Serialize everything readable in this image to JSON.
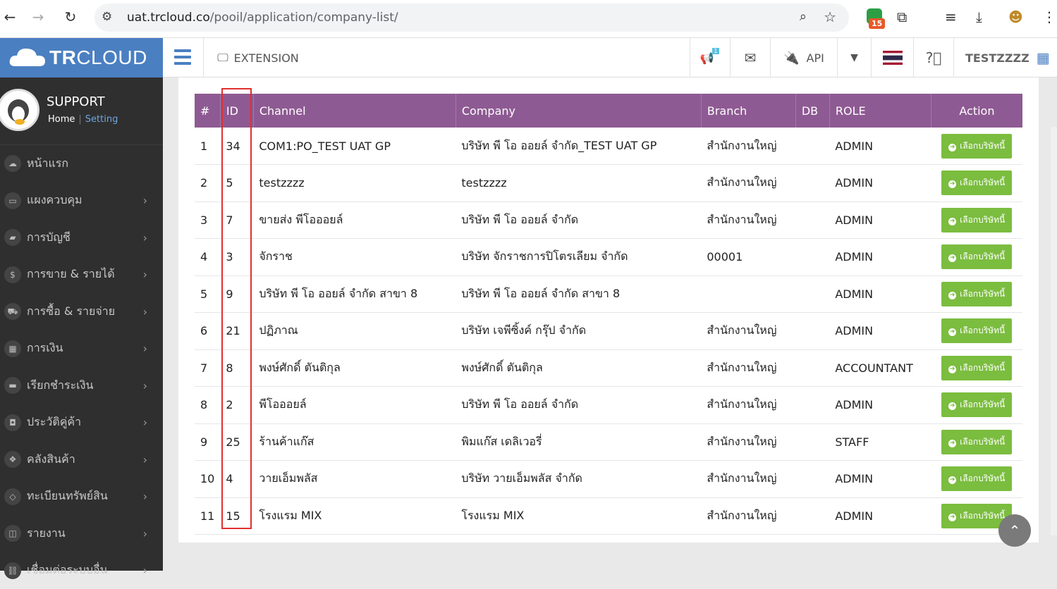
{
  "browser": {
    "url_host": "uat.trcloud.co",
    "url_path": "/pooil/application/company-list/",
    "ext_badge": "15"
  },
  "header": {
    "logo_text_bold": "TR",
    "logo_text_light": "CLOUD",
    "extension_label": "EXTENSION",
    "api_label": "API",
    "user_label": "TESTZZZZ",
    "notification_badge": "1"
  },
  "sidebar": {
    "profile_name": "SUPPORT",
    "home_link": "Home",
    "setting_link": "Setting",
    "items": [
      {
        "label": "หน้าแรก",
        "icon": "cloud-icon",
        "chevron": false
      },
      {
        "label": "แผงควบคุม",
        "icon": "monitor-icon",
        "chevron": true
      },
      {
        "label": "การบัญชี",
        "icon": "book-icon",
        "chevron": true
      },
      {
        "label": "การขาย & รายได้",
        "icon": "dollar-icon",
        "chevron": true
      },
      {
        "label": "การซื้อ & รายจ่าย",
        "icon": "cart-icon",
        "chevron": true
      },
      {
        "label": "การเงิน",
        "icon": "calendar-icon",
        "chevron": true
      },
      {
        "label": "เรียกชำระเงิน",
        "icon": "credit-card-icon",
        "chevron": true
      },
      {
        "label": "ประวัติคู่ค้า",
        "icon": "contact-icon",
        "chevron": true
      },
      {
        "label": "คลังสินค้า",
        "icon": "boxes-icon",
        "chevron": true
      },
      {
        "label": "ทะเบียนทรัพย์สิน",
        "icon": "diamond-icon",
        "chevron": true
      },
      {
        "label": "รายงาน",
        "icon": "report-icon",
        "chevron": true
      },
      {
        "label": "เชื่อมต่อระบบอื่น",
        "icon": "link-icon",
        "chevron": true
      }
    ]
  },
  "table": {
    "headers": [
      "#",
      "ID",
      "Channel",
      "Company",
      "Branch",
      "DB",
      "ROLE",
      "Action"
    ],
    "button_label": "เลือกบริษัทนี้",
    "rows": [
      [
        "1",
        "34",
        "COM1:PO_TEST UAT GP",
        "บริษัท พี โอ ออยล์ จำกัด_TEST UAT GP",
        "สำนักงานใหญ่",
        "",
        "ADMIN"
      ],
      [
        "2",
        "5",
        "testzzzz",
        "testzzzz",
        "สำนักงานใหญ่",
        "",
        "ADMIN"
      ],
      [
        "3",
        "7",
        "ขายส่ง พีโอออยล์",
        "บริษัท พี โอ ออยล์ จำกัด",
        "สำนักงานใหญ่",
        "",
        "ADMIN"
      ],
      [
        "4",
        "3",
        "จักราช",
        "บริษัท จักราชการปิโตรเลียม จำกัด",
        "00001",
        "",
        "ADMIN"
      ],
      [
        "5",
        "9",
        "บริษัท พี โอ ออยล์ จำกัด สาขา 8",
        "บริษัท พี โอ ออยล์ จำกัด สาขา 8",
        "",
        "",
        "ADMIN"
      ],
      [
        "6",
        "21",
        "ปฏิภาณ",
        "บริษัท เจพีซิ้งค์ กรุ๊ป จำกัด",
        "สำนักงานใหญ่",
        "",
        "ADMIN"
      ],
      [
        "7",
        "8",
        "พงษ์ศักดิ์ ตันติกุล",
        "พงษ์ศักดิ์ ตันติกุล",
        "สำนักงานใหญ่",
        "",
        "ACCOUNTANT"
      ],
      [
        "8",
        "2",
        "พีโอออยล์",
        "บริษัท พี โอ ออยล์ จำกัด",
        "สำนักงานใหญ่",
        "",
        "ADMIN"
      ],
      [
        "9",
        "25",
        "ร้านค้าแก๊ส",
        "พิมแก๊ส เดลิเวอรี่",
        "สำนักงานใหญ่",
        "",
        "STAFF"
      ],
      [
        "10",
        "4",
        "วายเอ็มพลัส",
        "บริษัท วายเอ็มพลัส จำกัด",
        "สำนักงานใหญ่",
        "",
        "ADMIN"
      ],
      [
        "11",
        "15",
        "โรงแรม MIX",
        "โรงแรม MIX",
        "สำนักงานใหญ่",
        "",
        "ADMIN"
      ]
    ]
  },
  "colors": {
    "header_purple": "#8e5a93",
    "button_green": "#7bbd3f",
    "logo_blue": "#4a7fc1",
    "sidebar_bg": "#2f2f2f",
    "highlight_red": "#e03030"
  }
}
